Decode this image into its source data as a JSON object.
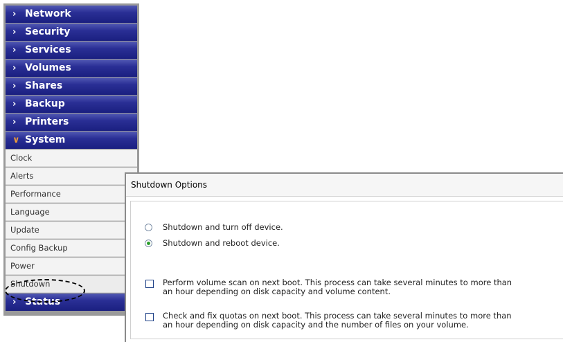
{
  "sidebar": {
    "nav": [
      {
        "label": "Network",
        "chevron": ">"
      },
      {
        "label": "Security",
        "chevron": ">"
      },
      {
        "label": "Services",
        "chevron": ">"
      },
      {
        "label": "Volumes",
        "chevron": ">"
      },
      {
        "label": "Shares",
        "chevron": ">"
      },
      {
        "label": "Backup",
        "chevron": ">"
      },
      {
        "label": "Printers",
        "chevron": ">"
      },
      {
        "label": "System",
        "chevron": "v"
      }
    ],
    "system_items": [
      "Clock",
      "Alerts",
      "Performance",
      "Language",
      "Update",
      "Config Backup",
      "Power",
      "Shutdown"
    ],
    "status": {
      "label": "Status",
      "chevron": ">"
    }
  },
  "panel": {
    "title": "Shutdown Options",
    "radios": [
      {
        "label": "Shutdown and turn off device.",
        "checked": false
      },
      {
        "label": "Shutdown and reboot device.",
        "checked": true
      }
    ],
    "checkboxes": [
      {
        "line1": "Perform volume scan on next boot. This process can take several minutes to more than",
        "line2": "an hour depending on disk capacity and volume content.",
        "checked": false
      },
      {
        "line1": "Check and fix quotas on next boot. This process can take several minutes to more than",
        "line2": "an hour depending on disk capacity and the number of files on your volume.",
        "checked": false
      }
    ]
  },
  "colors": {
    "nav_bg": "#1b1f80",
    "sub_bg": "#f3f3f3",
    "radio_dot": "#2c9f2c",
    "expanded_chevron": "#e89a3c"
  }
}
